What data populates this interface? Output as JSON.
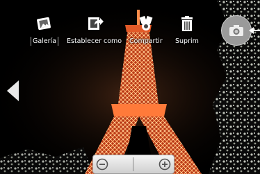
{
  "toolbar": {
    "items": [
      {
        "label": "Galería",
        "icon": "gallery-icon"
      },
      {
        "label": "Establecer como",
        "icon": "set-as-icon"
      },
      {
        "label": "Compartir",
        "icon": "share-icon"
      },
      {
        "label": "Suprim",
        "icon": "trash-icon"
      }
    ]
  },
  "camera": {
    "icon": "camera-icon"
  },
  "navigation": {
    "prev_icon": "chevron-left-icon"
  },
  "zoom": {
    "out_icon": "zoom-out-icon",
    "in_icon": "zoom-in-icon"
  },
  "colors": {
    "tower": "#e8502a",
    "tower_light": "#ff9a5a",
    "foliage": "#cfd3c8",
    "sky": "#000000"
  }
}
